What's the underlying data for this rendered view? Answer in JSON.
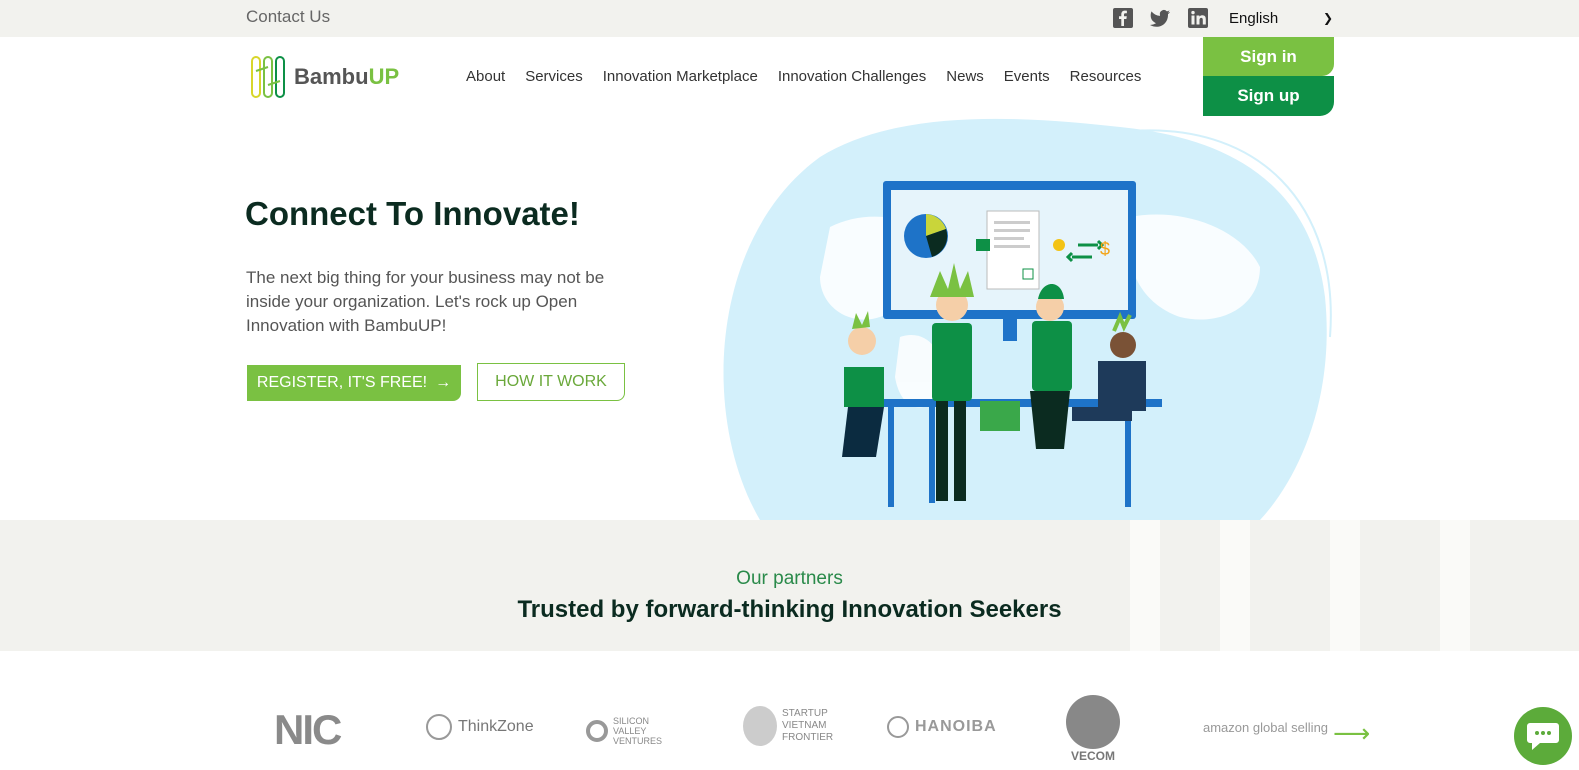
{
  "topbar": {
    "contact_label": "Contact Us",
    "social": [
      "facebook-icon",
      "twitter-icon",
      "linkedin-icon"
    ],
    "language": "English"
  },
  "header": {
    "logo_text_1": "Bambu",
    "logo_text_2": "UP",
    "nav": [
      "About",
      "Services",
      "Innovation Marketplace",
      "Innovation Challenges",
      "News",
      "Events",
      "Resources"
    ],
    "signin_label": "Sign in",
    "signup_label": "Sign up"
  },
  "hero": {
    "title": "Connect To Innovate!",
    "subtitle": "The next big thing for your business may not be inside your organization. Let's rock up Open Innovation with BambuUP!",
    "register_label": "REGISTER, IT'S FREE!",
    "how_label": "HOW IT WORK"
  },
  "partners": {
    "eyebrow": "Our partners",
    "title": "Trusted by forward-thinking Innovation Seekers",
    "logos": [
      {
        "name": "NIC"
      },
      {
        "name": "ThinkZone"
      },
      {
        "name": "SILICON VALLEY VENTURES"
      },
      {
        "name": "STARTUP VIETNAM FRONTIER"
      },
      {
        "name": "HANOIBA"
      },
      {
        "name": "VECOM"
      },
      {
        "name": "amazon global selling"
      }
    ]
  },
  "colors": {
    "brand_green": "#7ac142",
    "dark_green": "#0d9046",
    "heading": "#0b2b20",
    "band": "#f2f2ee"
  }
}
